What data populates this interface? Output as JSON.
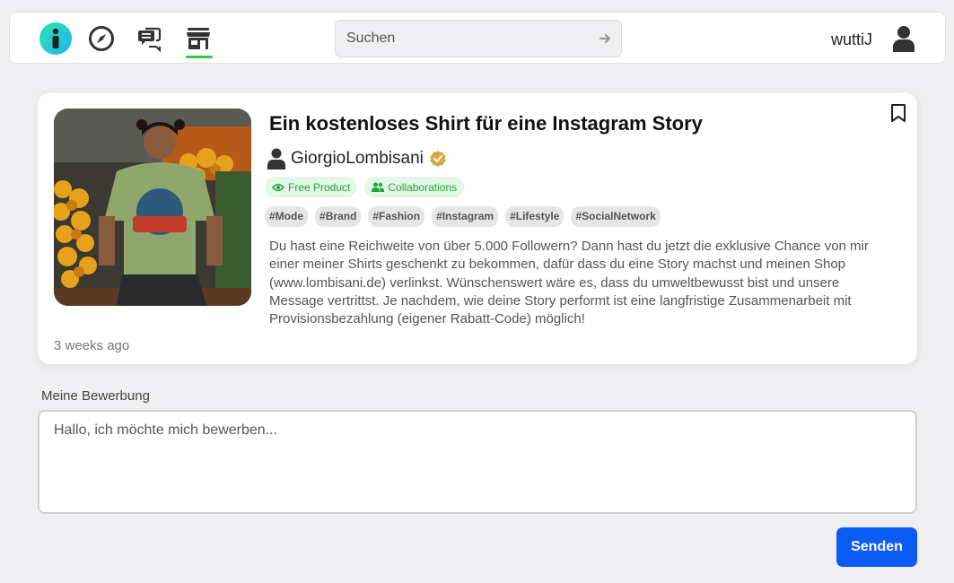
{
  "header": {
    "nav": [
      {
        "name": "info-icon"
      },
      {
        "name": "compass-icon"
      },
      {
        "name": "chat-icon"
      },
      {
        "name": "shop-icon",
        "active": true
      }
    ],
    "search": {
      "placeholder": "Suchen"
    },
    "username": "wuttiJ"
  },
  "offer": {
    "title": "Ein kostenloses Shirt für eine Instagram Story",
    "author": "GiorgioLombisani",
    "badges": [
      "Free Product",
      "Collaborations"
    ],
    "tags": [
      "#Mode",
      "#Brand",
      "#Fashion",
      "#Instagram",
      "#Lifestyle",
      "#SocialNetwork"
    ],
    "description": "Du hast eine Reichweite von über 5.000 Followern? Dann hast du jetzt die exklusive Chance von mir einer meiner Shirts geschenkt zu bekommen, dafür dass du eine Story machst und meinen Shop (www.lombisani.de) verlinkst. Wünschenswert wäre es, dass du umweltbewusst bist und unsere Message vertrittst. Je nachdem, wie deine Story performt ist eine langfristige Zusammenarbeit mit Provisionsbezahlung (eigener Rabatt-Code) möglich!",
    "posted": "3 weeks ago"
  },
  "application": {
    "label": "Meine Bewerbung",
    "placeholder": "Hallo, ich möchte mich bewerben...",
    "value": "",
    "submit_label": "Senden"
  },
  "colors": {
    "accent": "#0a5cf5",
    "badge_green": "#27a33a",
    "active_underline": "#2ecc40",
    "verified": "#d4a94a"
  }
}
